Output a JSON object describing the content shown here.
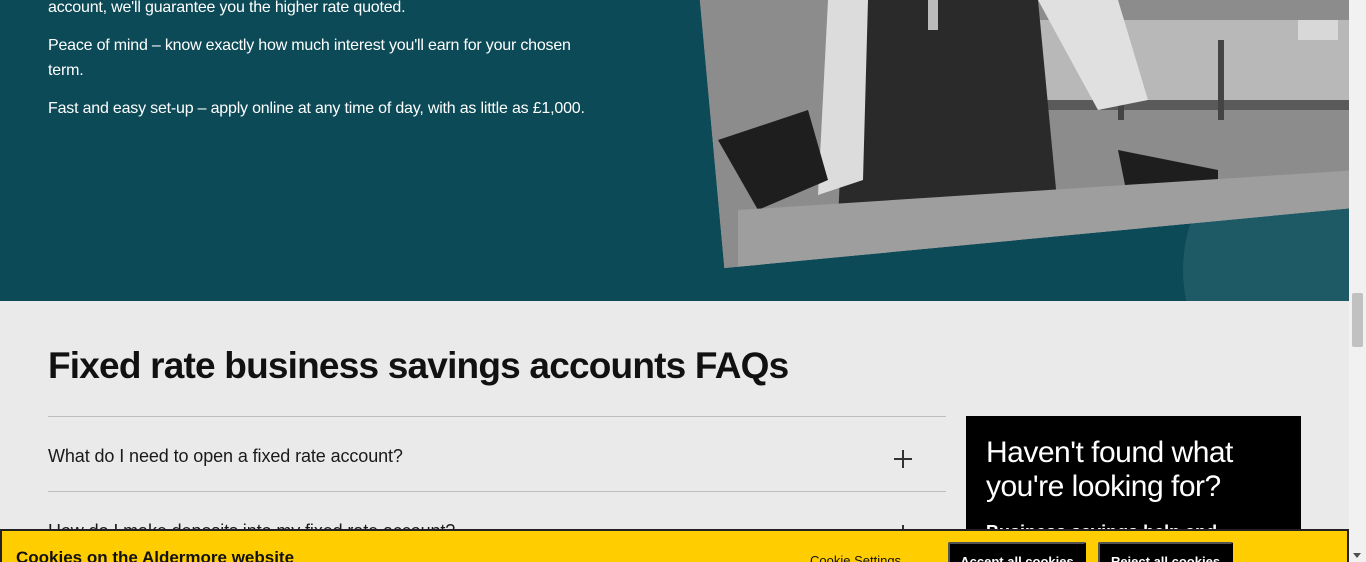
{
  "hero": {
    "paragraph_1": "account, we'll guarantee you the higher rate quoted.",
    "paragraph_2": "Peace of mind – know exactly how much interest you'll earn for your chosen term.",
    "paragraph_3": "Fast and easy set-up – apply online at any time of day, with as little as £1,000."
  },
  "faq": {
    "title": "Fixed rate business savings accounts FAQs",
    "items": [
      {
        "question": "What do I need to open a fixed rate account?"
      },
      {
        "question": "How do I make deposits into my fixed rate account?"
      }
    ]
  },
  "sidebar": {
    "title": "Haven't found what you're looking for?",
    "subtitle": "Business savings help and support"
  },
  "cookie_banner": {
    "title": "Cookies on the Aldermore website",
    "settings_label": "Cookie Settings",
    "accept_label": "Accept all cookies",
    "reject_label": "Reject all cookies"
  },
  "colors": {
    "hero_background": "#0b4a56",
    "cookie_background": "#ffcd00",
    "sidebar_background": "#000000"
  },
  "icons": [
    "plus-icon",
    "chevron-down-icon"
  ]
}
